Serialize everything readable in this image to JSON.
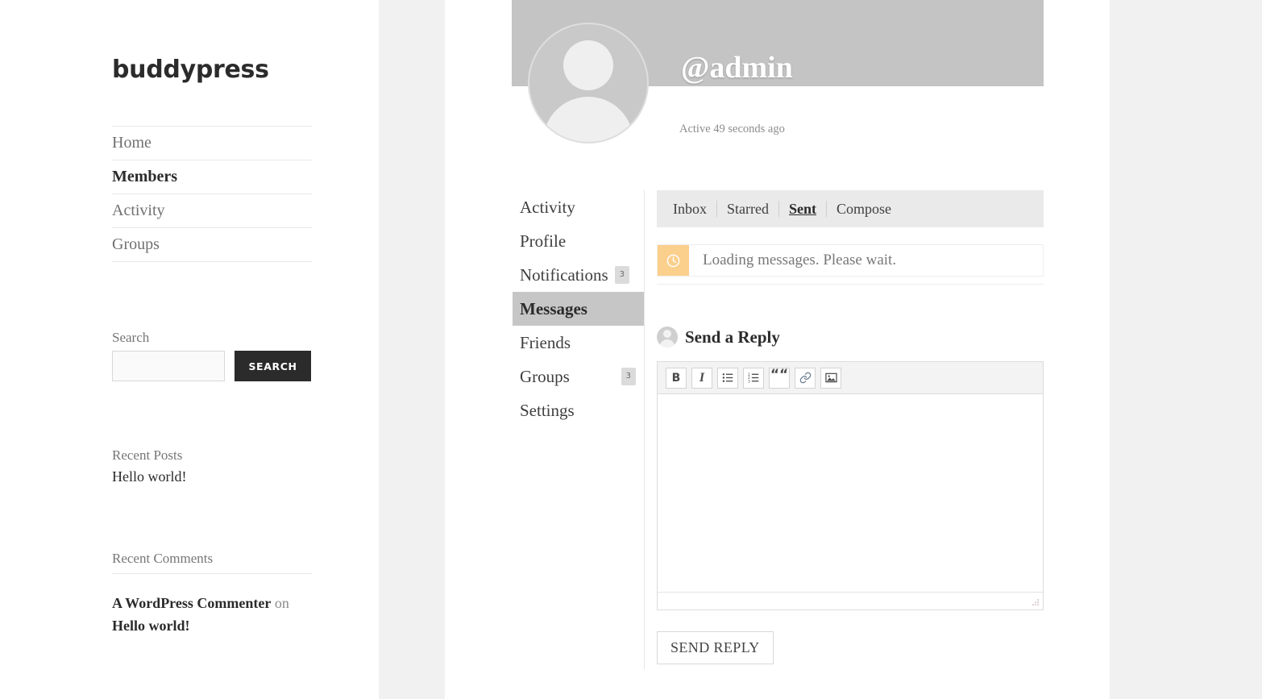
{
  "site": {
    "title": "buddypress"
  },
  "sidebar": {
    "nav_items": [
      {
        "label": "Home",
        "current": false
      },
      {
        "label": "Members",
        "current": true
      },
      {
        "label": "Activity",
        "current": false
      },
      {
        "label": "Groups",
        "current": false
      }
    ],
    "search": {
      "label": "Search",
      "value": "",
      "placeholder": "",
      "button_label": "SEARCH"
    },
    "recent_posts": {
      "title": "Recent Posts",
      "items": [
        "Hello world!"
      ]
    },
    "recent_comments": {
      "title": "Recent Comments",
      "items": [
        {
          "author": "A WordPress Commenter",
          "connector": "on",
          "post": "Hello world!"
        }
      ]
    }
  },
  "profile": {
    "name": "@admin",
    "activity": "Active 49 seconds ago",
    "avatar_icon": "default-user-avatar",
    "nav_items": [
      {
        "label": "Activity",
        "count": null,
        "current": false
      },
      {
        "label": "Profile",
        "count": null,
        "current": false
      },
      {
        "label": "Notifications",
        "count": "3",
        "current": false
      },
      {
        "label": "Messages",
        "count": null,
        "current": true
      },
      {
        "label": "Friends",
        "count": null,
        "current": false
      },
      {
        "label": "Groups",
        "count": "3",
        "current": false
      },
      {
        "label": "Settings",
        "count": null,
        "current": false
      }
    ]
  },
  "messages": {
    "tabs": [
      {
        "label": "Inbox",
        "current": false
      },
      {
        "label": "Starred",
        "current": false
      },
      {
        "label": "Sent",
        "current": true
      },
      {
        "label": "Compose",
        "current": false
      }
    ],
    "notice": {
      "icon": "clock-icon",
      "text": "Loading messages. Please wait.",
      "icon_bg": "#fbcf8c"
    },
    "reply": {
      "title": "Send a Reply",
      "avatar_icon": "default-user-avatar",
      "editor_value": "",
      "editor_placeholder": "",
      "toolbar": [
        {
          "name": "bold-icon",
          "glyph": "B"
        },
        {
          "name": "italic-icon",
          "glyph": "I"
        },
        {
          "name": "unordered-list-icon",
          "glyph": ""
        },
        {
          "name": "ordered-list-icon",
          "glyph": ""
        },
        {
          "name": "blockquote-icon",
          "glyph": "““"
        },
        {
          "name": "link-icon",
          "glyph": ""
        },
        {
          "name": "image-icon",
          "glyph": ""
        }
      ],
      "submit_label": "SEND REPLY"
    }
  },
  "colors": {
    "header_bg": "#c4c4c4",
    "page_bg": "#f1f1f1",
    "content_bg": "#ffffff",
    "active_nav_bg": "#c6c6c6",
    "tabs_bg": "#eaeaea",
    "notice_icon_bg": "#fbcf8c",
    "search_button_bg": "#2b2b2b"
  }
}
